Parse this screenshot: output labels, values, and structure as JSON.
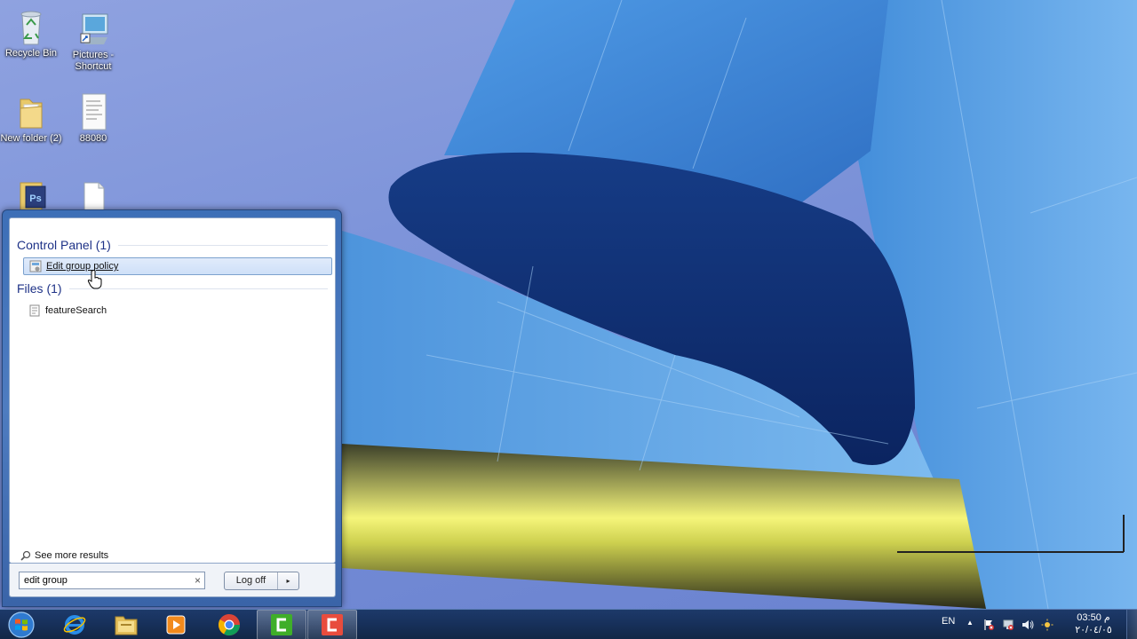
{
  "desktop": {
    "icons": [
      {
        "label": "Recycle Bin"
      },
      {
        "label": "Pictures - Shortcut"
      },
      {
        "label": "New folder (2)"
      },
      {
        "label": "88080"
      },
      {
        "label": ""
      },
      {
        "label": ""
      }
    ]
  },
  "start_menu": {
    "groups": [
      {
        "header": "Control Panel (1)",
        "items": [
          {
            "label": "Edit group policy",
            "selected": true
          }
        ]
      },
      {
        "header": "Files (1)",
        "items": [
          {
            "label": "featureSearch",
            "selected": false
          }
        ]
      }
    ],
    "see_more": "See more results",
    "search_value": "edit group",
    "search_clear": "×",
    "logoff_label": "Log off",
    "logoff_arrow": "▸"
  },
  "taskbar": {
    "apps": [
      "start-orb",
      "internet-explorer",
      "file-explorer",
      "media-player",
      "chrome",
      "camtasia-green",
      "camtasia-red"
    ],
    "tray": {
      "language": "EN",
      "overflow_arrow": "▲",
      "time": "03:50 م",
      "date": "٢٠/٠٤/٠٥"
    }
  },
  "colors": {
    "accent": "#1e3287",
    "selection": "#cfe0f8",
    "taskbar": "#17305a"
  }
}
